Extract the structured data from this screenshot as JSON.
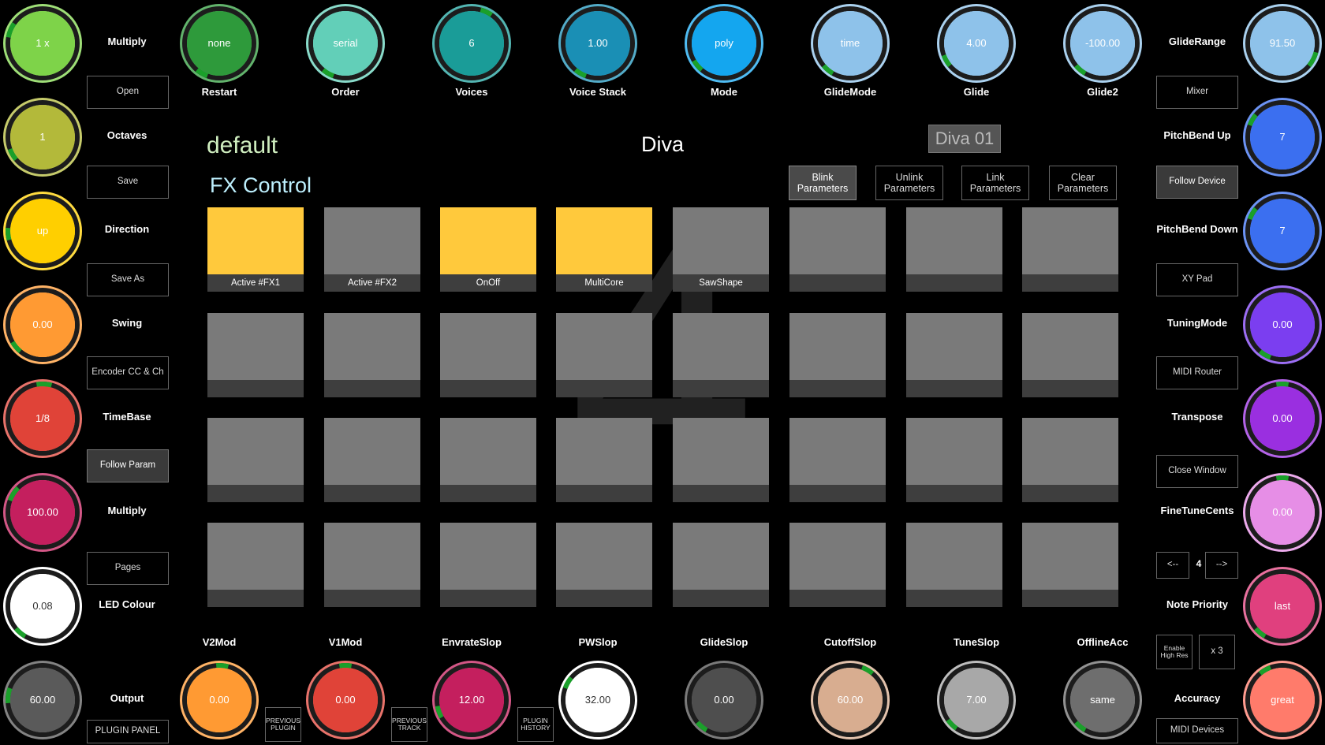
{
  "header": {
    "preset": "default",
    "plugin": "Diva",
    "instance": "Diva 01",
    "section": "FX Control",
    "page_watermark": "4"
  },
  "param_buttons": {
    "blink": "Blink\nParameters",
    "unlink": "Unlink\nParameters",
    "link": "Link\nParameters",
    "clear": "Clear\nParameters"
  },
  "colors": {
    "pad_on": "#ffc93c",
    "pad_off": "#7a7a7a",
    "arc_indicator": "#1aa02a"
  },
  "left_knobs": [
    {
      "value": "1 x",
      "color": "#7ed349",
      "label": "Multiply"
    },
    {
      "value": "1",
      "color": "#b3b93a",
      "label": "Octaves"
    },
    {
      "value": "up",
      "color": "#ffcf00",
      "label": "Direction"
    },
    {
      "value": "0.00",
      "color": "#ff9a33",
      "label": "Swing"
    },
    {
      "value": "1/8",
      "color": "#e04338",
      "label": "TimeBase"
    },
    {
      "value": "100.00",
      "color": "#c41f5e",
      "label": "Multiply"
    },
    {
      "value": "0.08",
      "color": "#ffffff",
      "label": "LED Colour"
    },
    {
      "value": "60.00",
      "color": "#5a5a5a",
      "label": "Output"
    }
  ],
  "left_buttons": [
    "Open",
    "Save",
    "Save As",
    "Encoder CC & Ch",
    "Follow Param",
    "Pages",
    "PLUGIN PANEL"
  ],
  "top_knobs": [
    {
      "value": "none",
      "color": "#2e9a3b",
      "label": "Restart"
    },
    {
      "value": "serial",
      "color": "#62cfb8",
      "label": "Order"
    },
    {
      "value": "6",
      "color": "#1a9c98",
      "label": "Voices"
    },
    {
      "value": "1.00",
      "color": "#1a8fb5",
      "label": "Voice Stack"
    },
    {
      "value": "poly",
      "color": "#14a6ef",
      "label": "Mode"
    },
    {
      "value": "time",
      "color": "#8ec2ea",
      "label": "GlideMode"
    },
    {
      "value": "4.00",
      "color": "#8ec2ea",
      "label": "Glide"
    },
    {
      "value": "-100.00",
      "color": "#8ec2ea",
      "label": "Glide2"
    }
  ],
  "bottom_knobs": [
    {
      "value": "0.00",
      "color": "#ff9a33",
      "label": "V2Mod"
    },
    {
      "value": "0.00",
      "color": "#e04338",
      "label": "V1Mod"
    },
    {
      "value": "12.00",
      "color": "#c41f5e",
      "label": "EnvrateSlop"
    },
    {
      "value": "32.00",
      "color": "#ffffff",
      "label": "PWSlop"
    },
    {
      "value": "0.00",
      "color": "#4e4e4e",
      "label": "GlideSlop"
    },
    {
      "value": "60.00",
      "color": "#d8ad90",
      "label": "CutoffSlop"
    },
    {
      "value": "7.00",
      "color": "#a8a8a8",
      "label": "TuneSlop"
    },
    {
      "value": "same",
      "color": "#6e6e6e",
      "label": "OfflineAcc"
    }
  ],
  "bottom_small_buttons": [
    "PREVIOUS\nPLUGIN",
    "PREVIOUS\nTRACK",
    "PLUGIN\nHISTORY"
  ],
  "right_knobs": [
    {
      "value": "91.50",
      "color": "#8ec2ea",
      "label": "GlideRange"
    },
    {
      "value": "7",
      "color": "#3b6ff0",
      "label": "PitchBend Up"
    },
    {
      "value": "7",
      "color": "#3b6ff0",
      "label": "PitchBend Down"
    },
    {
      "value": "0.00",
      "color": "#7b3ef0",
      "label": "TuningMode"
    },
    {
      "value": "0.00",
      "color": "#9a2fe0",
      "label": "Transpose"
    },
    {
      "value": "0.00",
      "color": "#e68ee6",
      "label": "FineTuneCents"
    },
    {
      "value": "last",
      "color": "#e0407e",
      "label": "Note Priority"
    },
    {
      "value": "great",
      "color": "#ff7b6b",
      "label": "Accuracy"
    }
  ],
  "right_buttons": [
    "Mixer",
    "Follow Device",
    "XY Pad",
    "MIDI Router",
    "Close Window",
    "MIDI Devices"
  ],
  "nav": {
    "prev": "<--",
    "page": "4",
    "next": "-->"
  },
  "high_res": {
    "enable": "Enable\nHigh Res",
    "multiplier": "x 3"
  },
  "pads": [
    {
      "label": "Active #FX1",
      "on": true
    },
    {
      "label": "Active #FX2",
      "on": false
    },
    {
      "label": "OnOff",
      "on": true
    },
    {
      "label": "MultiCore",
      "on": true
    },
    {
      "label": "SawShape",
      "on": false
    },
    {
      "label": "",
      "on": false
    },
    {
      "label": "",
      "on": false
    },
    {
      "label": "",
      "on": false
    },
    {
      "label": "",
      "on": false
    },
    {
      "label": "",
      "on": false
    },
    {
      "label": "",
      "on": false
    },
    {
      "label": "",
      "on": false
    },
    {
      "label": "",
      "on": false
    },
    {
      "label": "",
      "on": false
    },
    {
      "label": "",
      "on": false
    },
    {
      "label": "",
      "on": false
    },
    {
      "label": "",
      "on": false
    },
    {
      "label": "",
      "on": false
    },
    {
      "label": "",
      "on": false
    },
    {
      "label": "",
      "on": false
    },
    {
      "label": "",
      "on": false
    },
    {
      "label": "",
      "on": false
    },
    {
      "label": "",
      "on": false
    },
    {
      "label": "",
      "on": false
    },
    {
      "label": "",
      "on": false
    },
    {
      "label": "",
      "on": false
    },
    {
      "label": "",
      "on": false
    },
    {
      "label": "",
      "on": false
    },
    {
      "label": "",
      "on": false
    },
    {
      "label": "",
      "on": false
    },
    {
      "label": "",
      "on": false
    },
    {
      "label": "",
      "on": false
    }
  ]
}
